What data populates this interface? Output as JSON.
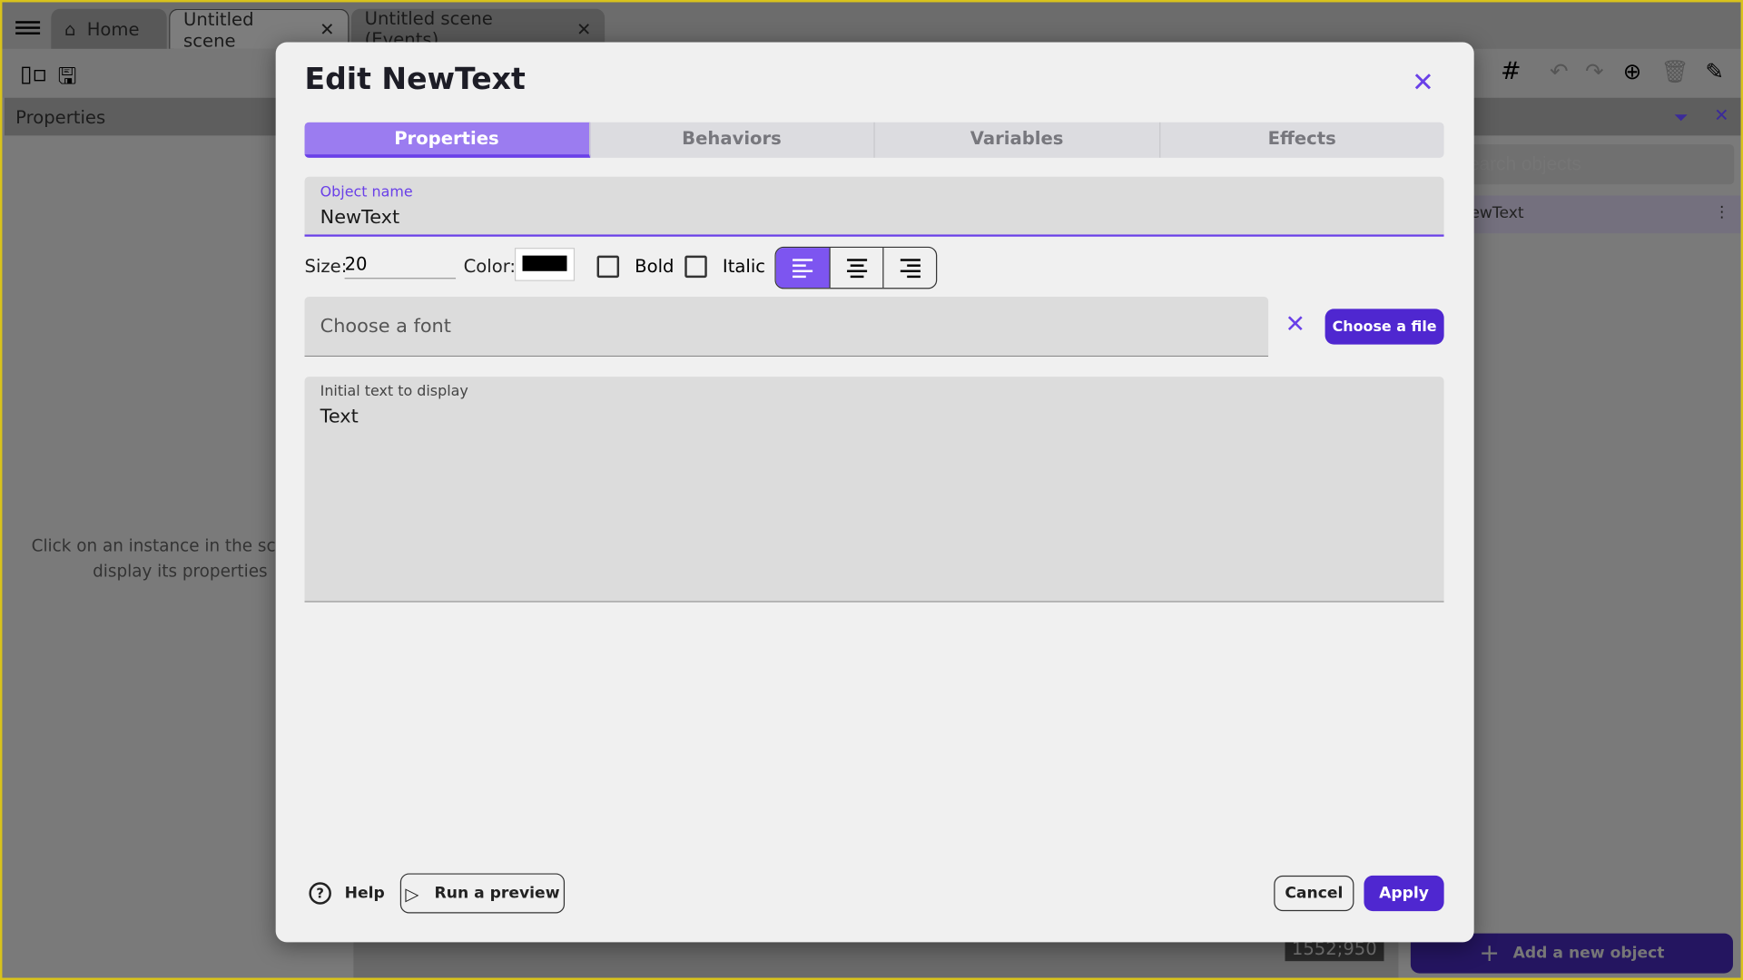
{
  "app": {
    "tabs": [
      {
        "label": "Home",
        "icon": "home-icon"
      },
      {
        "label": "Untitled scene",
        "active": true
      },
      {
        "label": "Untitled scene (Events)"
      }
    ],
    "left_panel": {
      "title": "Properties",
      "empty_message": "Click on an instance in the scene to display its properties"
    },
    "right_panel": {
      "search_placeholder": "Search objects",
      "objects": [
        "NewText"
      ],
      "add_button": "Add a new object"
    },
    "coords": "1552;950"
  },
  "dialog": {
    "title": "Edit NewText",
    "tabs": [
      "Properties",
      "Behaviors",
      "Variables",
      "Effects"
    ],
    "object_name_label": "Object name",
    "object_name": "NewText",
    "size_label": "Size:",
    "size": "20",
    "color_label": "Color:",
    "color": "#000000",
    "bold_label": "Bold",
    "italic_label": "Italic",
    "bold": false,
    "italic": false,
    "alignment": "left",
    "font_placeholder": "Choose a font",
    "choose_file": "Choose a file",
    "text_label": "Initial text to display",
    "text": "Text",
    "help": "Help",
    "preview": "Run a preview",
    "cancel": "Cancel",
    "apply": "Apply"
  },
  "colors": {
    "accent": "#6a40e8",
    "primary_button": "#4f27d0"
  }
}
